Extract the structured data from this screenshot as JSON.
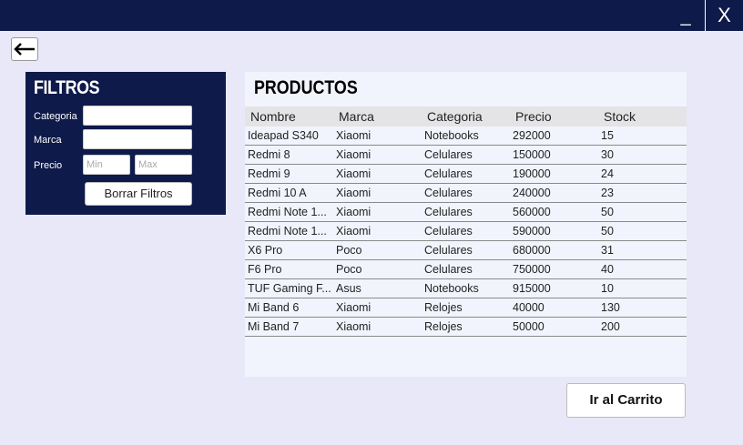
{
  "window": {
    "minimize_label": "_",
    "close_label": "X"
  },
  "back_button": {
    "icon": "arrow-left-icon"
  },
  "filters": {
    "title": "FILTROS",
    "category_label": "Categoria",
    "brand_label": "Marca",
    "price_label": "Precio",
    "price_min_placeholder": "Min",
    "price_max_placeholder": "Max",
    "clear_button": "Borrar Filtros"
  },
  "products": {
    "title": "PRODUCTOS",
    "columns": [
      "Nombre",
      "Marca",
      "Categoria",
      "Precio",
      "Stock"
    ],
    "rows": [
      [
        "Ideapad S340",
        "Xiaomi",
        "Notebooks",
        "292000",
        "15"
      ],
      [
        "Redmi 8",
        "Xiaomi",
        "Celulares",
        "150000",
        "30"
      ],
      [
        "Redmi 9",
        "Xiaomi",
        "Celulares",
        "190000",
        "24"
      ],
      [
        "Redmi 10 A",
        "Xiaomi",
        "Celulares",
        "240000",
        "23"
      ],
      [
        "Redmi Note 1...",
        "Xiaomi",
        "Celulares",
        "560000",
        "50"
      ],
      [
        "Redmi Note 1...",
        "Xiaomi",
        "Celulares",
        "590000",
        "50"
      ],
      [
        "X6 Pro",
        "Poco",
        "Celulares",
        "680000",
        "31"
      ],
      [
        "F6 Pro",
        "Poco",
        "Celulares",
        "750000",
        "40"
      ],
      [
        "TUF Gaming F...",
        "Asus",
        "Notebooks",
        "915000",
        "10"
      ],
      [
        "Mi Band 6",
        "Xiaomi",
        "Relojes",
        "40000",
        "130"
      ],
      [
        "Mi Band 7",
        "Xiaomi",
        "Relojes",
        "50000",
        "200"
      ]
    ]
  },
  "cart_button": "Ir al Carrito"
}
